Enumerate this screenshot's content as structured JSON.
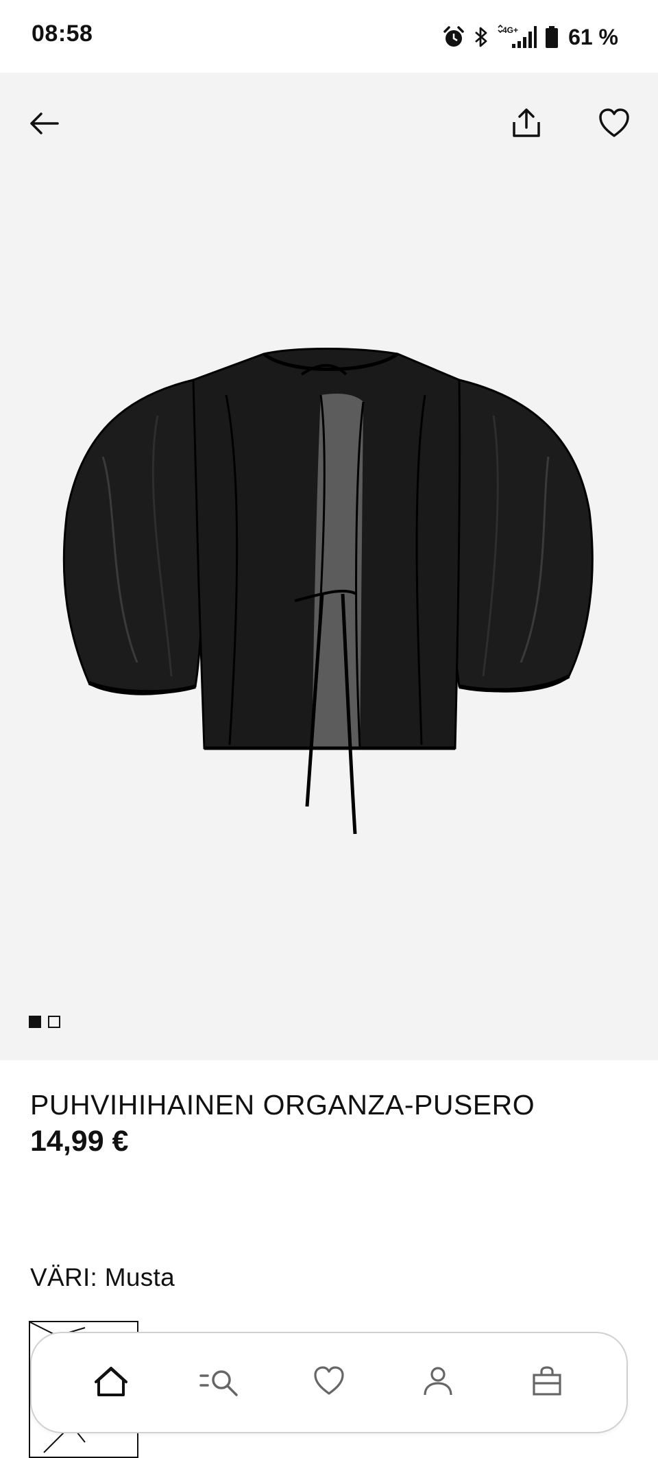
{
  "status_bar": {
    "time": "08:58",
    "network": "4G+",
    "battery": "61 %",
    "icons": [
      "alarm-icon",
      "bluetooth-icon",
      "signal-icon",
      "battery-icon"
    ]
  },
  "header": {
    "back_icon": "arrow-left-icon",
    "share_icon": "share-icon",
    "favorite_icon": "heart-icon"
  },
  "gallery": {
    "image_count": 2,
    "active_index": 0
  },
  "product": {
    "title": "PUHVIHIHAINEN ORGANZA-PUSERO",
    "price": "14,99 €",
    "color_label": "VÄRI: Musta"
  },
  "bottom_nav": {
    "items": [
      {
        "icon": "home-icon",
        "active": true
      },
      {
        "icon": "search-menu-icon",
        "active": false
      },
      {
        "icon": "heart-icon",
        "active": false
      },
      {
        "icon": "account-icon",
        "active": false
      },
      {
        "icon": "shopping-bag-icon",
        "active": false
      }
    ]
  },
  "colors": {
    "background": "#ffffff",
    "image_background": "#f3f3f3",
    "text": "#111111",
    "nav_border": "#d0d0d0"
  }
}
